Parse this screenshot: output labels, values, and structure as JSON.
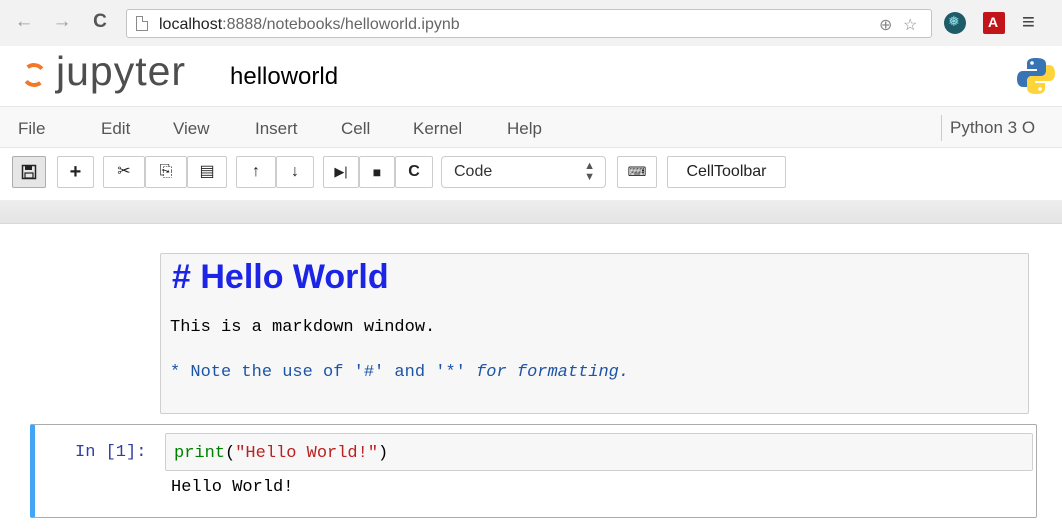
{
  "browser": {
    "title_fragment": "...jupyter...",
    "url_host": "localhost",
    "url_path": ":8888/notebooks/helloworld.ipynb",
    "icons": [
      "back-arrow-icon",
      "forward-arrow-icon",
      "reload-icon",
      "page-icon",
      "zoom-icon",
      "star-icon",
      "extension-icon",
      "pdf-icon",
      "menu-icon"
    ]
  },
  "header": {
    "logo_text": "jupyter",
    "notebook_name": "helloworld"
  },
  "menubar": {
    "items": [
      "File",
      "Edit",
      "View",
      "Insert",
      "Cell",
      "Kernel",
      "Help"
    ],
    "kernel": "Python 3 O"
  },
  "toolbar": {
    "cell_type": "Code",
    "celltoolbar_label": "CellToolbar",
    "buttons": [
      "save-icon",
      "add-cell-icon",
      "cut-icon",
      "copy-icon",
      "paste-icon",
      "move-up-icon",
      "move-down-icon",
      "run-icon",
      "stop-icon",
      "restart-icon",
      "keyboard-icon"
    ]
  },
  "cells": {
    "markdown": {
      "heading": "# Hello World",
      "line1": "This is a markdown window.",
      "line2_prefix": "* Note the use of '#' and '*' ",
      "line2_emph": "for formatting."
    },
    "code": {
      "prompt": "In [1]:",
      "code_fn": "print",
      "code_open": "(",
      "code_string": "\"Hello World!\"",
      "code_close": ")",
      "output": "Hello World!"
    }
  },
  "colors": {
    "heading": "#1c24e6",
    "markdown_note": "#1d55a5",
    "prompt": "#303f9f",
    "code_keyword": "#008000",
    "code_string": "#ba2121",
    "selected_cell_bar": "#42a5f5",
    "logo_orange": "#f37726"
  }
}
